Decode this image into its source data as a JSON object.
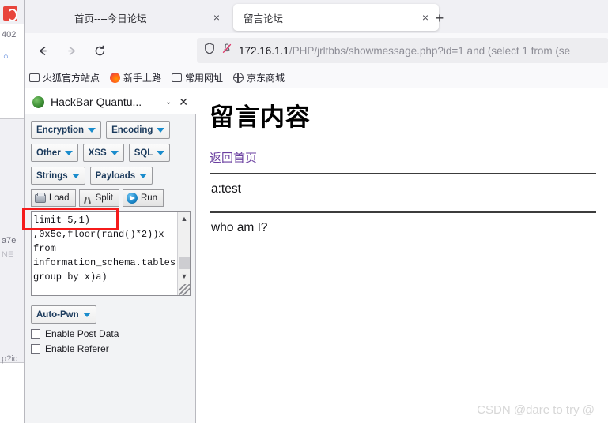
{
  "background_window": {
    "fragment_top": "402",
    "fragment_mid": "a7e",
    "fragment_mid2": "NE",
    "fragment_bottom": "p?id"
  },
  "browser": {
    "tabs": [
      {
        "title": "首页----今日论坛",
        "active": false,
        "close_label": "×"
      },
      {
        "title": "留言论坛",
        "active": true,
        "close_label": "×"
      }
    ],
    "new_tab_label": "+",
    "nav": {
      "back_label": "back-arrow",
      "forward_label": "forward-arrow",
      "reload_label": "reload"
    },
    "url": {
      "host": "172.16.1.1",
      "path": "/PHP/jrltbbs/showmessage.php?id=1 and (select 1 from (se",
      "shield_icon": "shield-icon",
      "permission_icon": "blocked-permission-icon"
    },
    "bookmarks": [
      {
        "label": "火狐官方站点",
        "icon": "folder-icon"
      },
      {
        "label": "新手上路",
        "icon": "firefox-icon"
      },
      {
        "label": "常用网址",
        "icon": "folder-icon"
      },
      {
        "label": "京东商城",
        "icon": "globe-icon"
      }
    ]
  },
  "sidebar": {
    "title": "HackBar Quantu...",
    "chevron_label": "⌄",
    "close_label": "✕",
    "buttons_row1": [
      {
        "label": "Encryption"
      },
      {
        "label": "Encoding"
      }
    ],
    "buttons_row2": [
      {
        "label": "Other"
      },
      {
        "label": "XSS"
      },
      {
        "label": "SQL"
      }
    ],
    "buttons_row3": [
      {
        "label": "Strings"
      },
      {
        "label": "Payloads"
      }
    ],
    "actions": [
      {
        "label": "Load",
        "icon": "load-icon"
      },
      {
        "label": "Split",
        "icon": "split-icon"
      },
      {
        "label": "Run",
        "icon": "run-icon"
      }
    ],
    "payload_textarea": "limit 5,1)\n,0x5e,floor(rand()*2))x\nfrom\ninformation_schema.tables\ngroup by x)a)",
    "auto_pwn_label": "Auto-Pwn",
    "checkboxes": [
      {
        "label": "Enable Post Data",
        "checked": false
      },
      {
        "label": "Enable Referer",
        "checked": false
      }
    ],
    "highlight_color": "#f51b1b"
  },
  "page": {
    "title": "留言内容",
    "back_link": "返回首页",
    "messages": [
      "a:test",
      "who am I?"
    ]
  },
  "watermark": "CSDN @dare to try @"
}
